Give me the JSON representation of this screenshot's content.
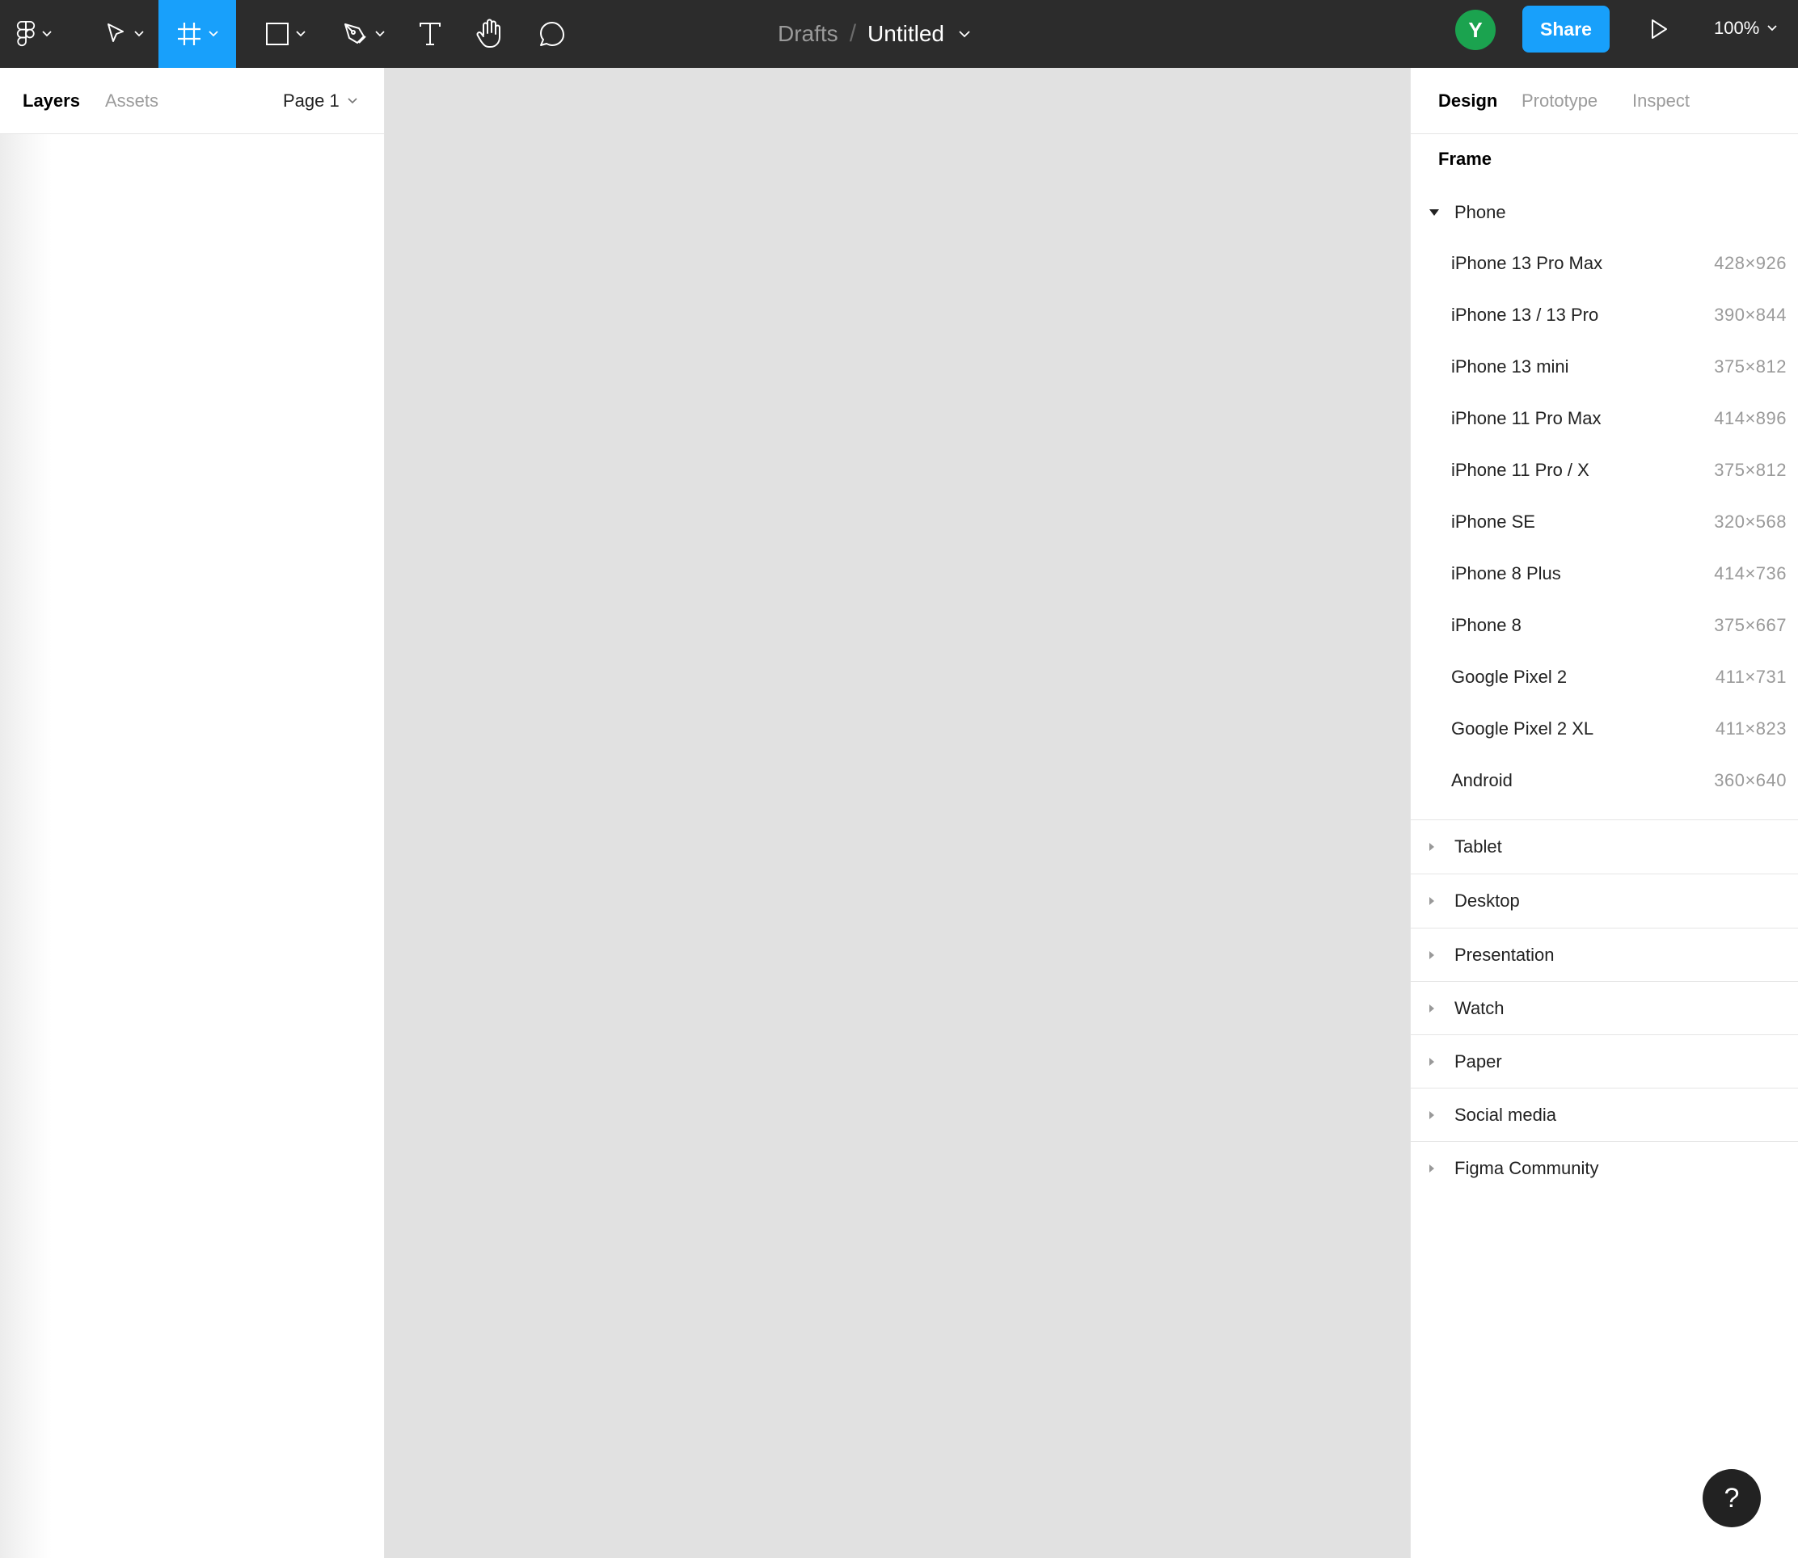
{
  "toolbar": {
    "tools": [
      {
        "name": "main-menu",
        "icon": "figma-logo-icon"
      },
      {
        "name": "move-tool",
        "icon": "cursor-arrow-icon"
      },
      {
        "name": "frame-tool",
        "icon": "frame-hash-icon",
        "active": true
      },
      {
        "name": "shape-tool",
        "icon": "rectangle-icon"
      },
      {
        "name": "pen-tool",
        "icon": "pen-icon"
      },
      {
        "name": "text-tool",
        "icon": "text-icon"
      },
      {
        "name": "hand-tool",
        "icon": "hand-icon"
      },
      {
        "name": "comment-tool",
        "icon": "comment-bubble-icon"
      }
    ],
    "breadcrumb": {
      "folder": "Drafts",
      "separator": "/",
      "file": "Untitled"
    },
    "avatar_initial": "Y",
    "share_label": "Share",
    "zoom": "100%",
    "accent_color": "#18a0fb",
    "avatar_color": "#1ba34f"
  },
  "left_panel": {
    "tabs": {
      "layers": "Layers",
      "assets": "Assets"
    },
    "page": "Page 1"
  },
  "right_panel": {
    "tabs": {
      "design": "Design",
      "prototype": "Prototype",
      "inspect": "Inspect"
    },
    "section_title": "Frame",
    "groups": {
      "phone": "Phone",
      "tablet": "Tablet",
      "desktop": "Desktop",
      "presentation": "Presentation",
      "watch": "Watch",
      "paper": "Paper",
      "social": "Social media",
      "community": "Figma Community"
    },
    "phone_presets": [
      {
        "name": "iPhone 13 Pro Max",
        "size": "428×926"
      },
      {
        "name": "iPhone 13 / 13 Pro",
        "size": "390×844"
      },
      {
        "name": "iPhone 13 mini",
        "size": "375×812"
      },
      {
        "name": "iPhone 11 Pro Max",
        "size": "414×896"
      },
      {
        "name": "iPhone 11 Pro / X",
        "size": "375×812"
      },
      {
        "name": "iPhone SE",
        "size": "320×568"
      },
      {
        "name": "iPhone 8 Plus",
        "size": "414×736"
      },
      {
        "name": "iPhone 8",
        "size": "375×667"
      },
      {
        "name": "Google Pixel 2",
        "size": "411×731"
      },
      {
        "name": "Google Pixel 2 XL",
        "size": "411×823"
      },
      {
        "name": "Android",
        "size": "360×640"
      }
    ]
  },
  "help": {
    "label": "?"
  }
}
